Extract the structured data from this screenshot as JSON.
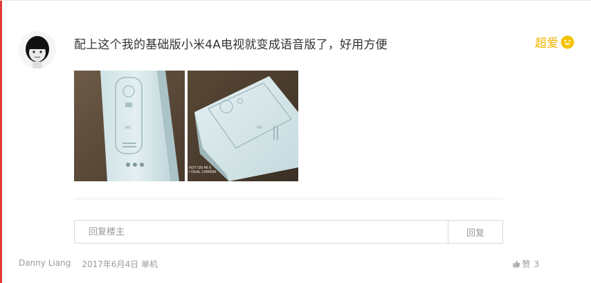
{
  "comment": {
    "text": "配上这个我的基础版小米4A电视就变成语音版了，好用方便",
    "rating_label": "超爱"
  },
  "photos": [
    {
      "caption": ""
    },
    {
      "caption": "HOT ON MI 6\nI DUAL CAMERA"
    }
  ],
  "reply": {
    "placeholder": "回复楼主",
    "button_label": "回复"
  },
  "footer": {
    "author": "Danny Liang",
    "date_device": "2017年6月4日 单机"
  },
  "like": {
    "label": "赞",
    "count": "3"
  },
  "colors": {
    "accent": "#e53935",
    "rating": "#f2b400"
  }
}
